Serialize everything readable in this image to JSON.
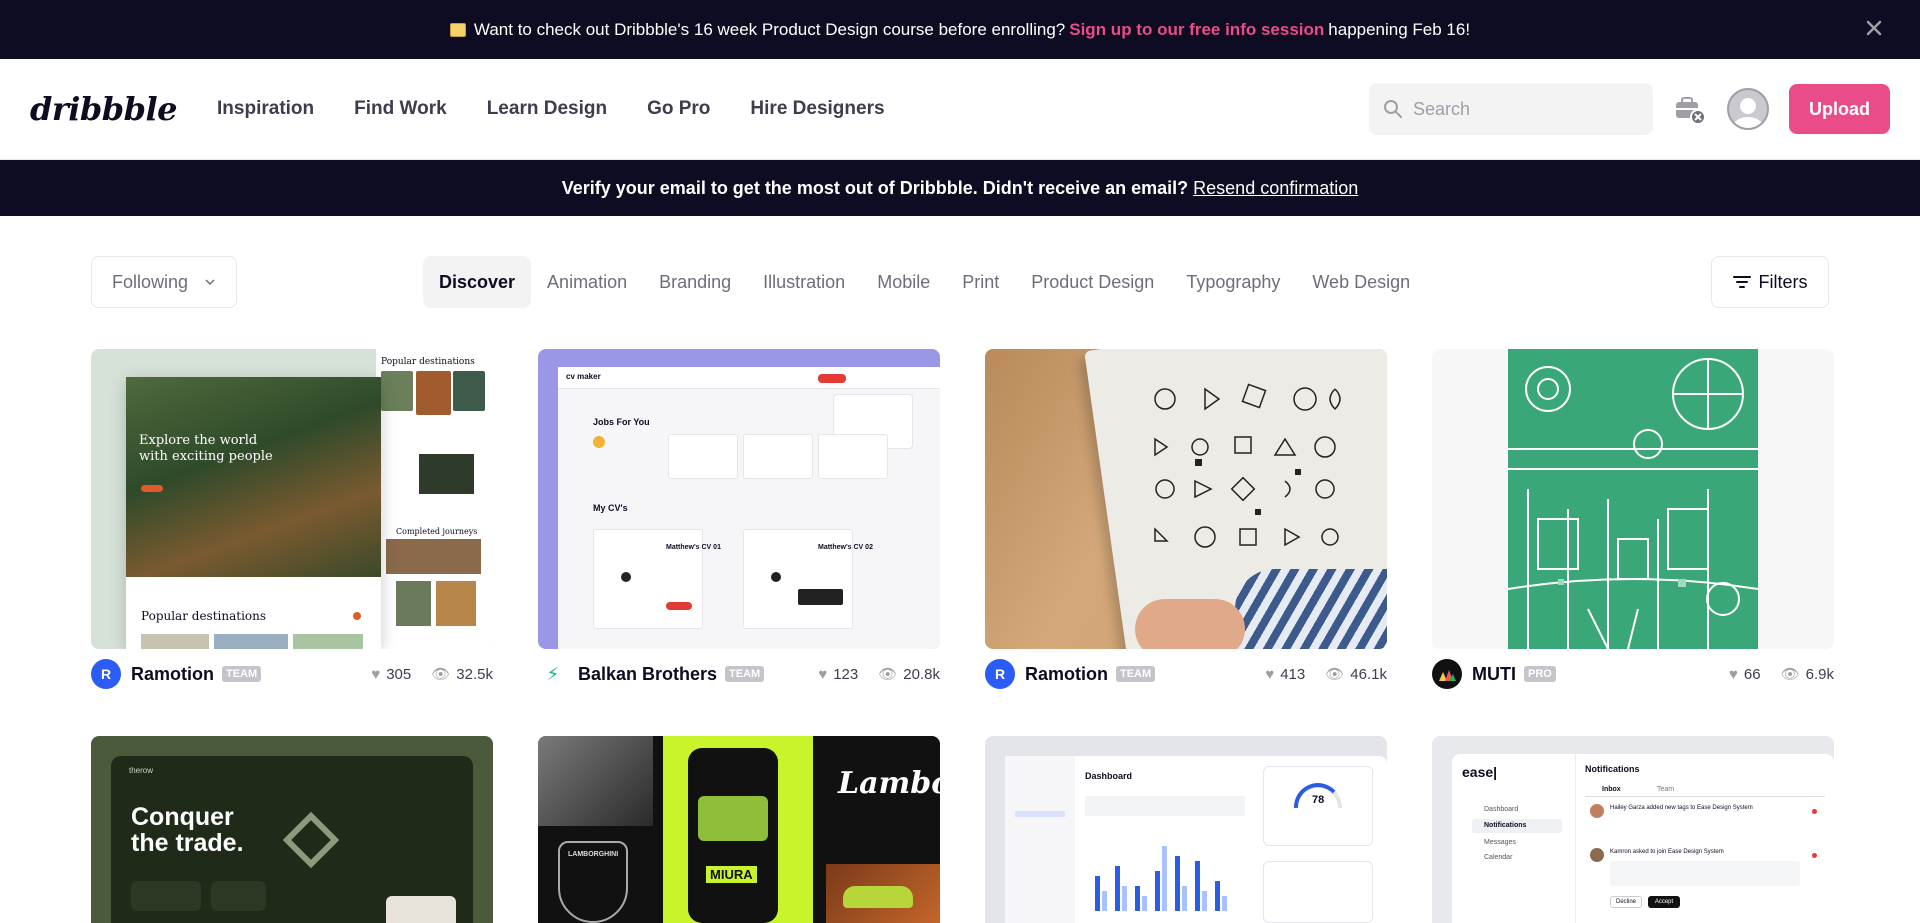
{
  "announcement": {
    "text_before": "Want to check out Dribbble's 16 week Product Design course before enrolling?",
    "link": "Sign up to our free info session",
    "text_after": "happening Feb 16!"
  },
  "header": {
    "logo": "dribbble",
    "nav": [
      "Inspiration",
      "Find Work",
      "Learn Design",
      "Go Pro",
      "Hire Designers"
    ],
    "search_placeholder": "Search",
    "upload_label": "Upload"
  },
  "verify_bar": {
    "text": "Verify your email to get the most out of Dribbble. Didn't receive an email?",
    "link": "Resend confirmation"
  },
  "filters": {
    "following_label": "Following",
    "categories": [
      "Discover",
      "Animation",
      "Branding",
      "Illustration",
      "Mobile",
      "Print",
      "Product Design",
      "Typography",
      "Web Design"
    ],
    "active_category": "Discover",
    "filters_label": "Filters"
  },
  "shots": [
    {
      "author": "Ramotion",
      "badge": "TEAM",
      "likes": "305",
      "views": "32.5k",
      "art": {
        "title": "Explore the world with exciting people",
        "subtitle": "Popular destinations",
        "side": "Completed journeys"
      }
    },
    {
      "author": "Balkan Brothers",
      "badge": "TEAM",
      "likes": "123",
      "views": "20.8k",
      "art": {
        "brand": "cv maker",
        "heading": "Jobs For You",
        "section": "My CV's",
        "cv1": "Matthew's CV 01",
        "cv2": "Matthew's CV 02"
      }
    },
    {
      "author": "Ramotion",
      "badge": "TEAM",
      "likes": "413",
      "views": "46.1k",
      "art": {}
    },
    {
      "author": "MUTI",
      "badge": "PRO",
      "likes": "66",
      "views": "6.9k",
      "art": {}
    },
    {
      "author": "",
      "badge": "",
      "likes": "",
      "views": "",
      "art": {
        "brand": "therow",
        "line1": "Conquer",
        "line2": "the trade."
      }
    },
    {
      "author": "",
      "badge": "",
      "likes": "",
      "views": "",
      "art": {
        "model": "MIURA",
        "brand": "LAMBORGHINI",
        "script": "Lambo"
      }
    },
    {
      "author": "",
      "badge": "",
      "likes": "",
      "views": "",
      "art": {
        "title": "Dashboard",
        "metric": "78"
      }
    },
    {
      "author": "",
      "badge": "",
      "likes": "",
      "views": "",
      "art": {
        "brand": "ease|",
        "title": "Notifications",
        "tab1": "Inbox",
        "tab2": "Team",
        "nav": [
          "Dashboard",
          "Notifications",
          "Messages",
          "Calendar"
        ],
        "n1": "Hailey Garza added new tags to Ease Design System",
        "n2": "Kamron asked to join Ease Design System",
        "decline": "Decline",
        "accept": "Accept"
      }
    }
  ],
  "colors": {
    "brand_pink": "#ea4c89",
    "dark": "#0d0c22"
  }
}
